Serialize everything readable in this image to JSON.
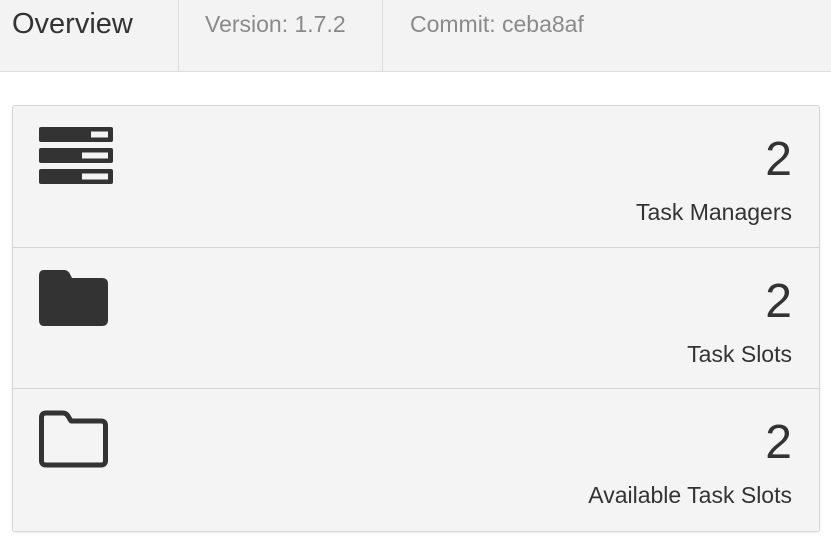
{
  "header": {
    "title": "Overview",
    "version": "Version: 1.7.2",
    "commit": "Commit: ceba8af"
  },
  "stats": [
    {
      "value": "2",
      "label": "Task Managers",
      "icon": "server-icon"
    },
    {
      "value": "2",
      "label": "Task Slots",
      "icon": "folder-filled-icon"
    },
    {
      "value": "2",
      "label": "Available Task Slots",
      "icon": "folder-outline-icon"
    }
  ],
  "colors": {
    "header_bg": "#f3f3f3",
    "panel_bg": "#f4f4f4",
    "text": "#333333",
    "muted_text": "#8a8a8a",
    "border": "#d6d6d6"
  }
}
